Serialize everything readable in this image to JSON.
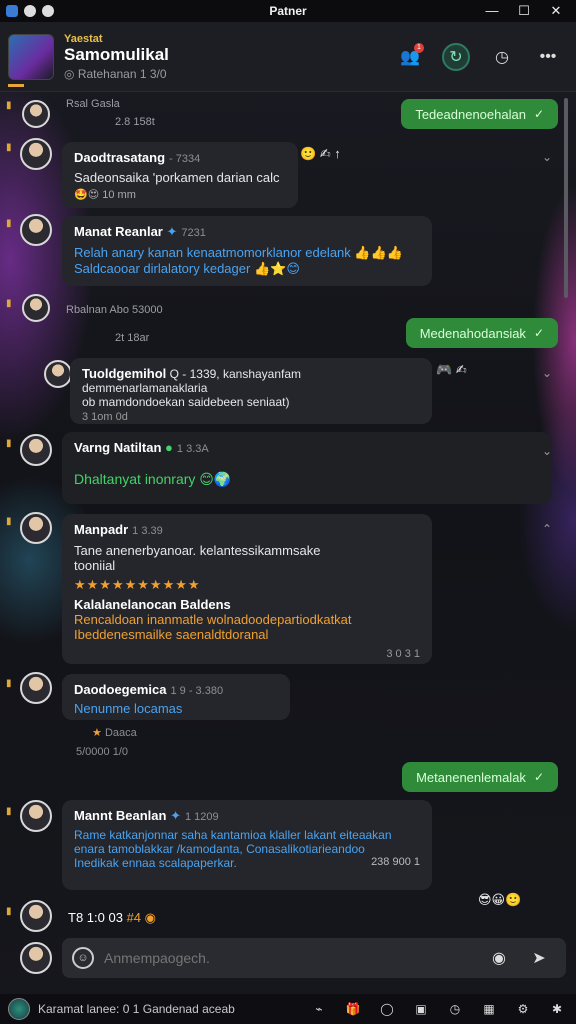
{
  "window": {
    "title": "Patner",
    "controls": [
      "—",
      "☐",
      "✕"
    ]
  },
  "header": {
    "tag": "Yaestat",
    "name": "Samomulikal",
    "subtitle": "Ratehanan 1 3/0",
    "icons": [
      "people-icon",
      "refresh-icon",
      "timer-icon",
      "more-icon"
    ],
    "badge": "1"
  },
  "messages": [
    {
      "type": "sys",
      "name": "Rsal Gasla",
      "time": "2.8 158t"
    },
    {
      "type": "out",
      "text": "Tedeadnenoehalan",
      "tick": "✓"
    },
    {
      "type": "in",
      "name": "Daodtrasatang",
      "time": "- 7334",
      "lines": [
        "Sadeonsaika 'porkamen darian calc"
      ],
      "meta": "10 mm",
      "reacts": "🤩😍"
    },
    {
      "type": "in",
      "name": "Manat Reanlar",
      "time": "7231",
      "lines": [
        "Relah anary kanan kenaatmomorklanor edelank",
        "Saldcaooar dirlalatory kedager"
      ],
      "emoji1": "👍👍👍",
      "emoji2": "👍⭐😊"
    },
    {
      "type": "sys",
      "name": "Rbalnan Abo 53000",
      "time": "2t 18ar"
    },
    {
      "type": "out",
      "text": "Medenahodansiak",
      "tick": "✓"
    },
    {
      "type": "in",
      "name": "Tuoldgemihol",
      "time": "Q - 1339,",
      "lines": [
        "kanshayanfam demmenarlamanaklaria",
        "ob mamdondoekan saidebeen seniaat)"
      ],
      "meta": "3 1om 0d"
    },
    {
      "type": "in",
      "name": "Varng Natiltan",
      "time": "1 3.3A",
      "lines": [
        "Dhaltanyat inonrary"
      ],
      "reacts": "😊🌍"
    },
    {
      "type": "in",
      "name": "Manpadr",
      "time": "1 3.39",
      "lines": [
        "Tane anenerbyanoar. kelantessikammsake",
        "tooniial"
      ],
      "stars": "★★★★★★★★★★",
      "sub_title": "Kalalanelanocan Baldens",
      "sub_lines": [
        "Rencaldoan inanmatle wolnadoodepartiodkatkat",
        "Ibeddenesmailke saenaldtdoranal"
      ],
      "meta": "3 0 3 1"
    },
    {
      "type": "in",
      "name": "Daodoegemica",
      "time": "1 9 - 3.380",
      "lines": [
        "Nenunme locamas"
      ],
      "meta": "Daaca",
      "meta2": "5/0000 1/0"
    },
    {
      "type": "out",
      "text": "Metanenenlemalak",
      "tick": "✓"
    },
    {
      "type": "in",
      "name": "Mannt Beanlan",
      "time": "1 1209",
      "lines": [
        "Rame katkanjonnar saha kantamioa klaller lakant eiteaakan",
        "enara tamoblakkar /kamodanta, Conasalikotiarieandoo",
        "Inedikak ennaa scalapaperkar."
      ],
      "meta": "238 900 1"
    },
    {
      "type": "sys",
      "name": "T8 1:0 03",
      "time": "#4"
    }
  ],
  "composer": {
    "placeholder": "Anmempaogech."
  },
  "bottom": {
    "status_text": "Karamat lanee: 0 1 Gandenad aceab",
    "icons": [
      "link-icon",
      "gift-icon",
      "ring-icon",
      "square-icon",
      "clock-icon",
      "calendar-icon",
      "gear-icon",
      "settings-icon"
    ]
  }
}
